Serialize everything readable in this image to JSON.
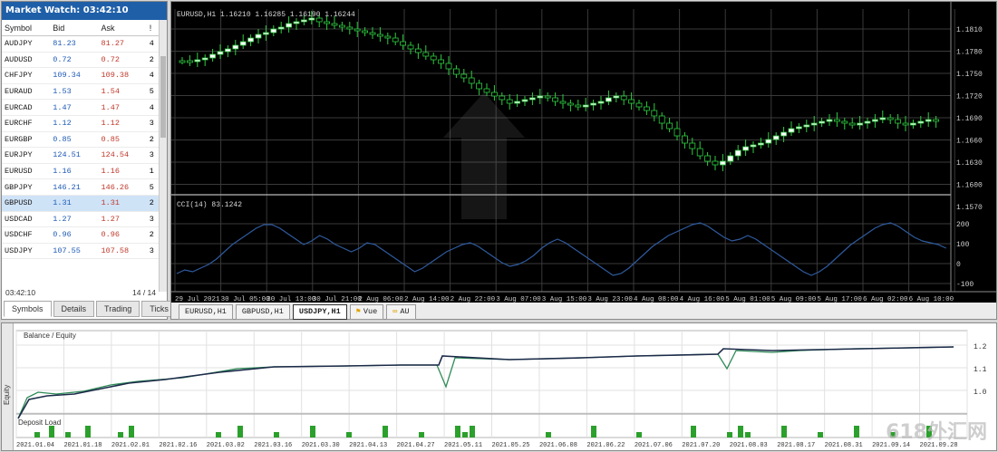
{
  "market_watch": {
    "title": "Market Watch: 03:42:10",
    "columns": [
      "Symbol",
      "Bid",
      "Ask",
      "!"
    ],
    "rows": [
      {
        "symbol": "AUDJPY",
        "bid": "81.23",
        "ask": "81.27",
        "spread": "4"
      },
      {
        "symbol": "AUDUSD",
        "bid": "0.72",
        "ask": "0.72",
        "spread": "2"
      },
      {
        "symbol": "CHFJPY",
        "bid": "109.34",
        "ask": "109.38",
        "spread": "4"
      },
      {
        "symbol": "EURAUD",
        "bid": "1.53",
        "ask": "1.54",
        "spread": "5"
      },
      {
        "symbol": "EURCAD",
        "bid": "1.47",
        "ask": "1.47",
        "spread": "4"
      },
      {
        "symbol": "EURCHF",
        "bid": "1.12",
        "ask": "1.12",
        "spread": "3"
      },
      {
        "symbol": "EURGBP",
        "bid": "0.85",
        "ask": "0.85",
        "spread": "2"
      },
      {
        "symbol": "EURJPY",
        "bid": "124.51",
        "ask": "124.54",
        "spread": "3"
      },
      {
        "symbol": "EURUSD",
        "bid": "1.16",
        "ask": "1.16",
        "spread": "1"
      },
      {
        "symbol": "GBPJPY",
        "bid": "146.21",
        "ask": "146.26",
        "spread": "5"
      },
      {
        "symbol": "GBPUSD",
        "bid": "1.31",
        "ask": "1.31",
        "spread": "2"
      },
      {
        "symbol": "USDCAD",
        "bid": "1.27",
        "ask": "1.27",
        "spread": "3"
      },
      {
        "symbol": "USDCHF",
        "bid": "0.96",
        "ask": "0.96",
        "spread": "2"
      },
      {
        "symbol": "USDJPY",
        "bid": "107.55",
        "ask": "107.58",
        "spread": "3"
      }
    ],
    "selected_row": 10,
    "footer_left": "03:42:10",
    "footer_right": "14 / 14",
    "tabs": [
      "Symbols",
      "Details",
      "Trading",
      "Ticks"
    ],
    "active_tab": 0
  },
  "chart": {
    "header": "EURUSD,H1 1.16210 1.16285 1.16190 1.16244",
    "indicator_header": "CCI(14) 83.1242",
    "price_labels": [
      "1.1810",
      "1.1780",
      "1.1750",
      "1.1720",
      "1.1690",
      "1.1660",
      "1.1630",
      "1.1600",
      "1.1570"
    ],
    "indicator_labels": [
      "200",
      "100",
      "0",
      "-100"
    ],
    "time_labels": [
      "29 Jul 2021",
      "30 Jul 05:00",
      "30 Jul 13:00",
      "30 Jul 21:00",
      "2 Aug 06:00",
      "2 Aug 14:00",
      "2 Aug 22:00",
      "3 Aug 07:00",
      "3 Aug 15:00",
      "3 Aug 23:00",
      "4 Aug 08:00",
      "4 Aug 16:00",
      "5 Aug 01:00",
      "5 Aug 09:00",
      "5 Aug 17:00",
      "6 Aug 02:00",
      "6 Aug 10:00"
    ],
    "tabs": [
      "EURUSD,H1",
      "GBPUSD,H1",
      "USDJPY,H1",
      "Vue",
      "AU"
    ],
    "active_tab": 2,
    "colors": {
      "background": "#000000",
      "grid": "#3a3a3a",
      "bull": "#ffffff",
      "bear": "#000000",
      "wick": "#2ecc40",
      "indicator": "#2f5b9f"
    }
  },
  "equity": {
    "title": "Balance / Equity",
    "side_label": "Equity",
    "volume_label": "Deposit Load",
    "y_labels": [
      "1.2",
      "1.1",
      "1.0"
    ],
    "date_labels": [
      "2021.01.04",
      "2021.01.18",
      "2021.02.01",
      "2021.02.16",
      "2021.03.02",
      "2021.03.16",
      "2021.03.30",
      "2021.04.13",
      "2021.04.27",
      "2021.05.11",
      "2021.05.25",
      "2021.06.08",
      "2021.06.22",
      "2021.07.06",
      "2021.07.20",
      "2021.08.03",
      "2021.08.17",
      "2021.08.31",
      "2021.09.14",
      "2021.09.28"
    ],
    "watermark": "618外汇网"
  }
}
